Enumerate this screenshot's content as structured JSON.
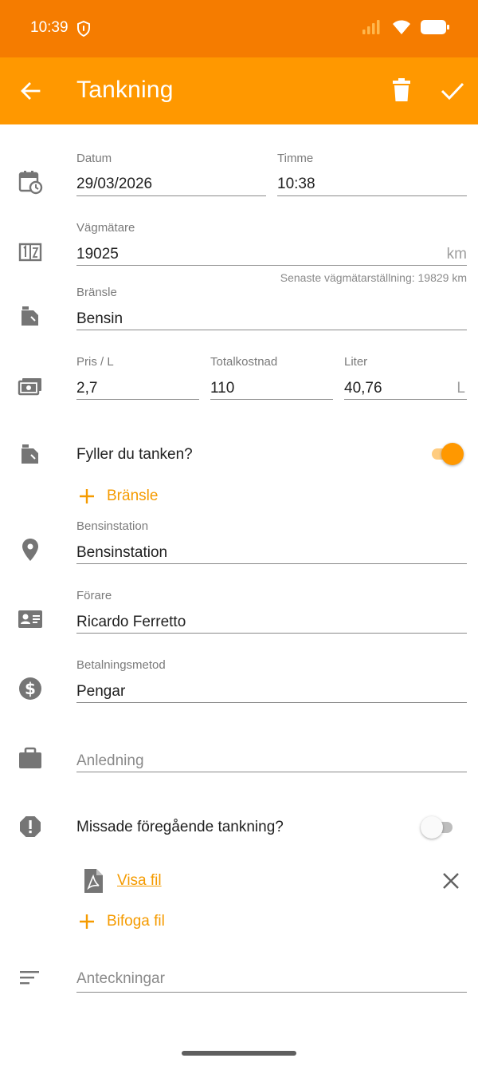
{
  "status_bar": {
    "time": "10:39"
  },
  "app_bar": {
    "title": "Tankning"
  },
  "date_time": {
    "date_label": "Datum",
    "date_value": "29/03/2026",
    "time_label": "Timme",
    "time_value": "10:38"
  },
  "odometer": {
    "label": "Vägmätare",
    "value": "19025",
    "unit": "km",
    "helper": "Senaste vägmätarställning: 19829 km"
  },
  "fuel": {
    "label": "Bränsle",
    "value": "Bensin"
  },
  "costs": {
    "price_label": "Pris / L",
    "price_value": "2,7",
    "total_label": "Totalkostnad",
    "total_value": "110",
    "liters_label": "Liter",
    "liters_value": "40,76",
    "liters_unit": "L"
  },
  "fill_tank": {
    "label": "Fyller du tanken?",
    "enabled": true
  },
  "add_fuel": {
    "label": "Bränsle"
  },
  "station": {
    "label": "Bensinstation",
    "value": "Bensinstation"
  },
  "driver": {
    "label": "Förare",
    "value": "Ricardo Ferretto"
  },
  "payment": {
    "label": "Betalningsmetod",
    "value": "Pengar"
  },
  "reason": {
    "placeholder": "Anledning"
  },
  "missed": {
    "label": "Missade föregående tankning?",
    "enabled": false
  },
  "attachment": {
    "link_label": "Visa fil",
    "icon": "pdf-file-icon"
  },
  "attach_file": {
    "label": "Bifoga fil"
  },
  "notes": {
    "placeholder": "Anteckningar"
  },
  "colors": {
    "status_bar": "#f57c00",
    "app_bar": "#ff9800",
    "accent": "#f59b00",
    "icon_gray": "#757575"
  }
}
